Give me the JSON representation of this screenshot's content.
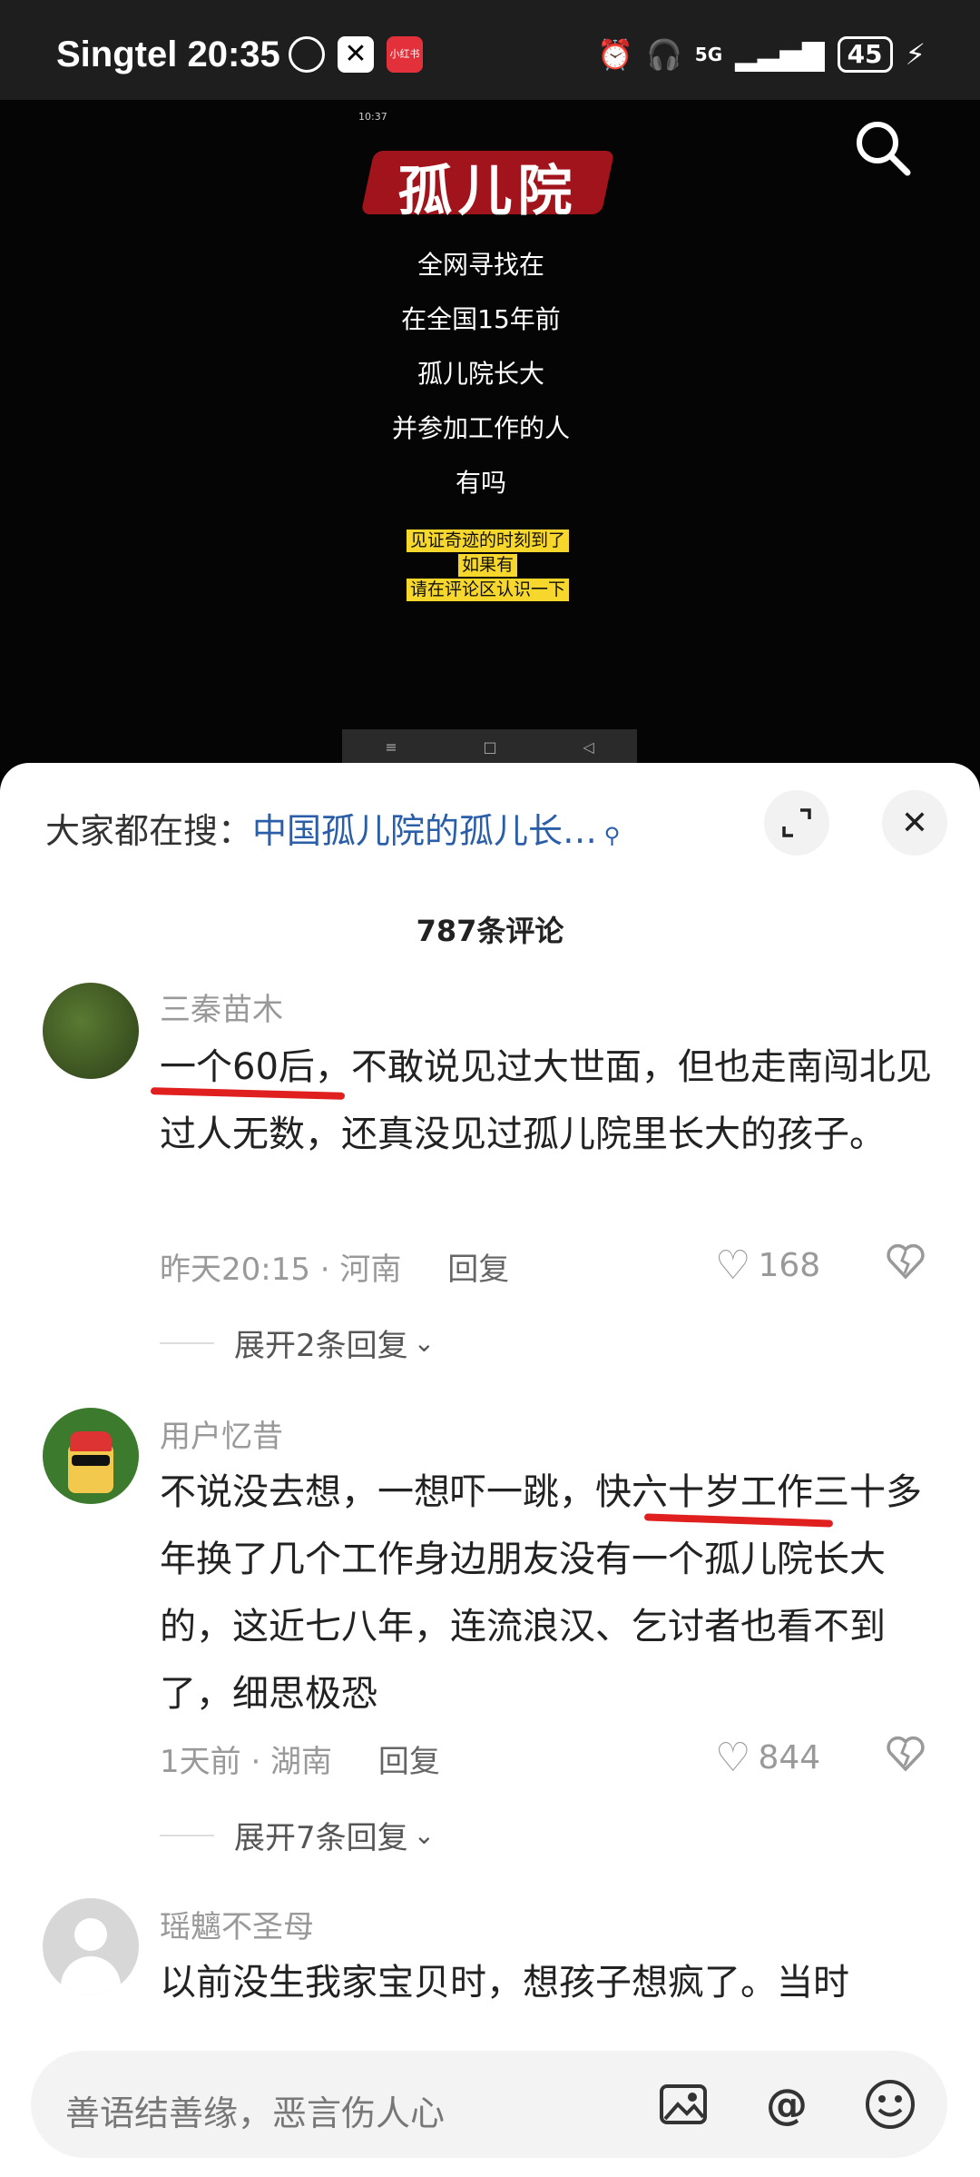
{
  "status_bar": {
    "carrier_time": "Singtel 20:35",
    "app_label": "小红书",
    "network": "5G",
    "battery": "45"
  },
  "video": {
    "inner_time": "10:37",
    "title": "孤儿院",
    "lines": [
      "全网寻找在",
      "在全国15年前",
      "孤儿院长大",
      "并参加工作的人",
      "有吗"
    ],
    "highlights": [
      "见证奇迹的时刻到了",
      "如果有",
      "请在评论区认识一下"
    ]
  },
  "sheet": {
    "search_prefix": "大家都在搜：",
    "search_query": "中国孤儿院的孤儿长…",
    "comment_count": "787条评论"
  },
  "comments": [
    {
      "user": "三秦苗木",
      "text": "一个60后，不敢说见过大世面，但也走南闯北见过人无数，还真没见过孤儿院里长大的孩子。",
      "meta": "昨天20:15 · 河南",
      "reply": "回复",
      "likes": "168",
      "expand": "展开2条回复"
    },
    {
      "user": "用户忆昔",
      "text": "不说没去想，一想吓一跳，快六十岁工作三十多年换了几个工作身边朋友没有一个孤儿院长大的，这近七八年，连流浪汉、乞讨者也看不到了，细思极恐",
      "meta": "1天前 · 湖南",
      "reply": "回复",
      "likes": "844",
      "expand": "展开7条回复"
    },
    {
      "user": "瑶魑不圣母",
      "text": "以前没生我家宝贝时，想孩子想疯了。当时"
    }
  ],
  "input": {
    "placeholder": "善语结善缘，恶言伤人心"
  },
  "colors": {
    "link_blue": "#2b5ea8",
    "annotation_red": "#e01f1f",
    "highlight_yellow": "#f7d72b"
  }
}
